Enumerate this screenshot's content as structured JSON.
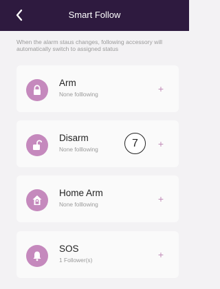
{
  "header": {
    "title": "Smart Follow"
  },
  "description": "When the alarm staus changes, following accessory will automatically switch to assigned status",
  "items": [
    {
      "title": "Arm",
      "subtitle": "None folllowing",
      "icon": "lock-icon",
      "action": "+"
    },
    {
      "title": "Disarm",
      "subtitle": "None folllowing",
      "icon": "unlock-icon",
      "action": "+"
    },
    {
      "title": "Home Arm",
      "subtitle": "None folllowing",
      "icon": "home-arm-icon",
      "action": "+"
    },
    {
      "title": "SOS",
      "subtitle": "1 Follower(s)",
      "icon": "bell-icon",
      "action": "+"
    }
  ],
  "annotation": {
    "label": "7"
  },
  "colors": {
    "header_bg": "#2e1a3f",
    "icon_circle": "#c589bd",
    "plus": "#c18bb8",
    "page_bg": "#f3f2f4",
    "card_bg": "#fafafa"
  }
}
